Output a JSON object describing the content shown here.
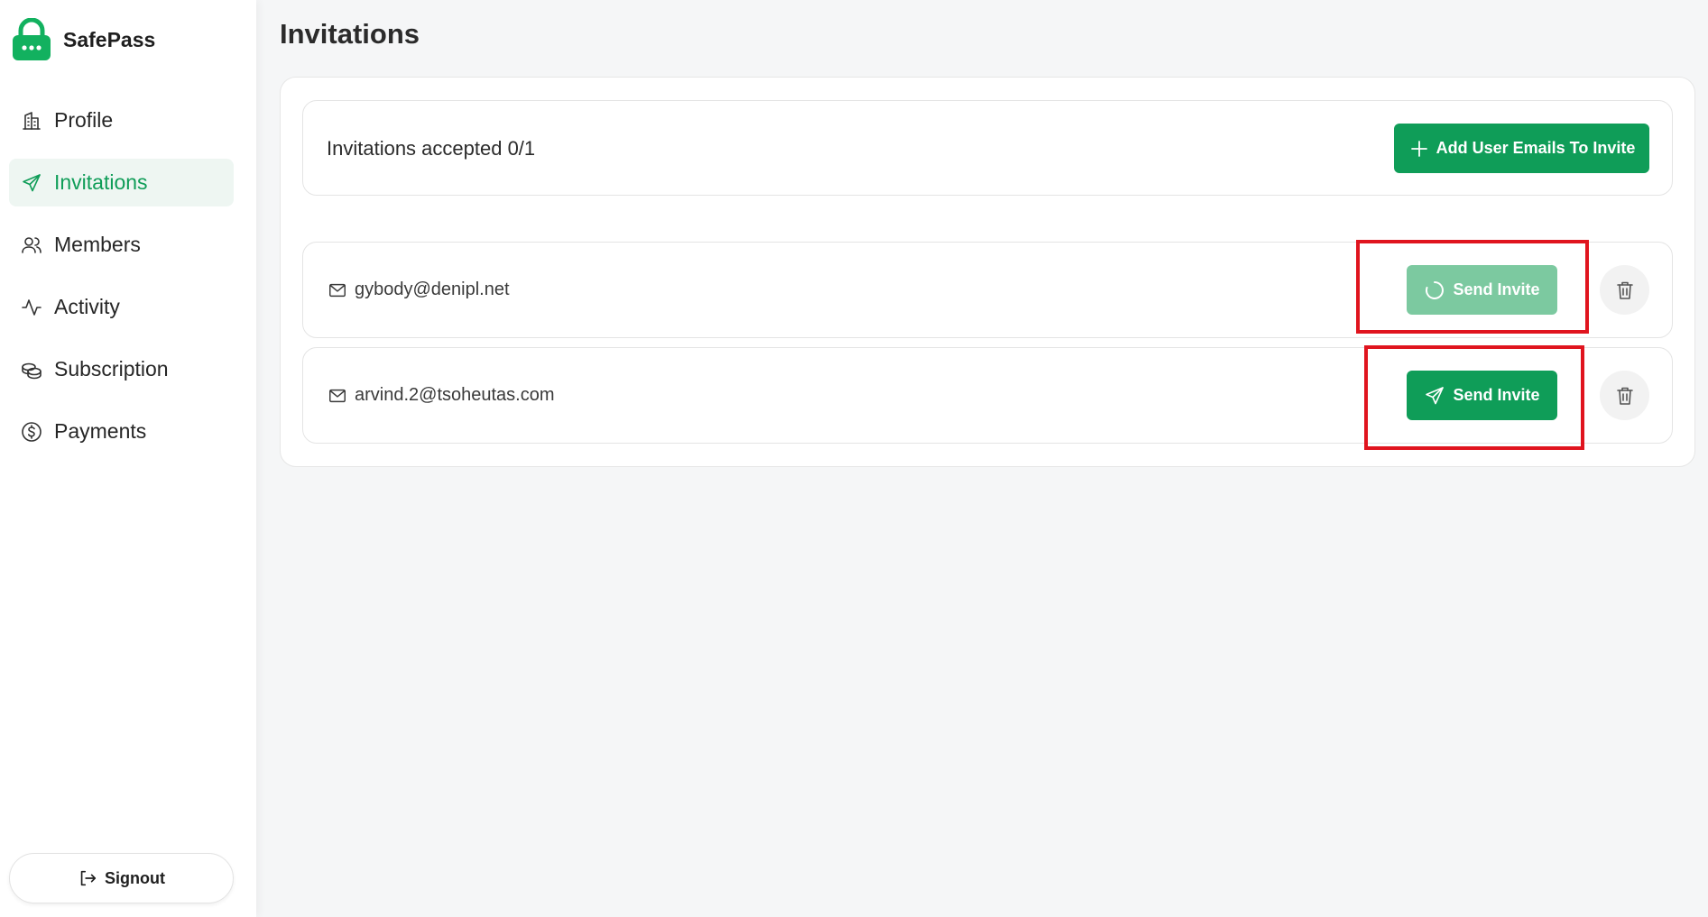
{
  "brand": {
    "name": "SafePass",
    "logo": "lock-icon",
    "accent": "#0f9d58"
  },
  "sidebar": {
    "items": [
      {
        "label": "Profile",
        "icon": "building-icon",
        "active": false
      },
      {
        "label": "Invitations",
        "icon": "send-icon",
        "active": true
      },
      {
        "label": "Members",
        "icon": "users-icon",
        "active": false
      },
      {
        "label": "Activity",
        "icon": "activity-icon",
        "active": false
      },
      {
        "label": "Subscription",
        "icon": "coins-icon",
        "active": false
      },
      {
        "label": "Payments",
        "icon": "dollar-circle-icon",
        "active": false
      }
    ],
    "signout_label": "Signout"
  },
  "page": {
    "title": "Invitations",
    "summary": "Invitations accepted 0/1",
    "add_button_label": "Add User Emails To Invite"
  },
  "invites": [
    {
      "email": "gybody@denipl.net",
      "button_label": "Send Invite",
      "state": "loading"
    },
    {
      "email": "arvind.2@tsoheutas.com",
      "button_label": "Send Invite",
      "state": "ready"
    }
  ],
  "colors": {
    "primary": "#0f9d58",
    "primary_loading": "#7cc9a0",
    "highlight": "#e0141e"
  }
}
